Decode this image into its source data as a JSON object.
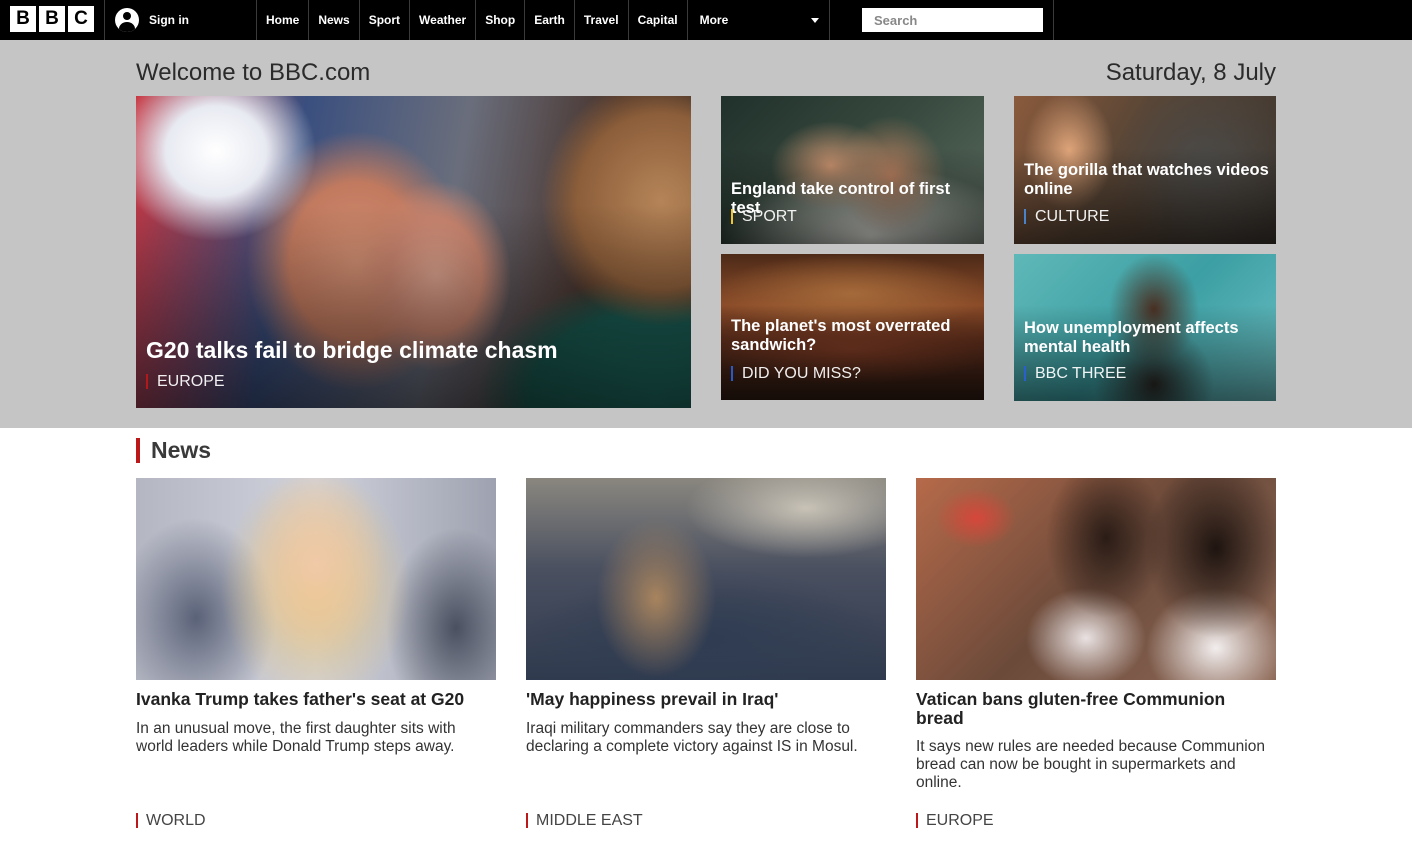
{
  "header": {
    "logo_letters": [
      "B",
      "B",
      "C"
    ],
    "signin_label": "Sign in",
    "nav": [
      "Home",
      "News",
      "Sport",
      "Weather",
      "Shop",
      "Earth",
      "Travel",
      "Capital"
    ],
    "more_label": "More",
    "search_placeholder": "Search"
  },
  "hero": {
    "welcome": "Welcome to BBC.com",
    "date": "Saturday, 8 July",
    "main": {
      "title": "G20 talks fail to bridge climate chasm",
      "tag": "EUROPE",
      "tag_color": "#bb1919"
    },
    "cards": [
      {
        "title": "England take control of first test",
        "tag": "SPORT",
        "tag_color": "#ffd230"
      },
      {
        "title": "The gorilla that watches videos online",
        "tag": "CULTURE",
        "tag_color": "#4a8bd6"
      },
      {
        "title": "The planet's most overrated sandwich?",
        "tag": "DID YOU MISS?",
        "tag_color": "#2a5fd6"
      },
      {
        "title": "How unemployment affects mental health",
        "tag": "BBC THREE",
        "tag_color": "#2a5fd6"
      }
    ]
  },
  "news": {
    "heading": "News",
    "accent": "#bb1919",
    "stories": [
      {
        "title": "Ivanka Trump takes father's seat at G20",
        "desc": "In an unusual move, the first daughter sits with world leaders while Donald Trump steps away.",
        "tag": "WORLD"
      },
      {
        "title": "'May happiness prevail in Iraq'",
        "desc": "Iraqi military commanders say they are close to declaring a complete victory against IS in Mosul.",
        "tag": "MIDDLE EAST"
      },
      {
        "title": "Vatican bans gluten-free Communion bread",
        "desc": "It says new rules are needed because Communion bread can now be bought in supermarkets and online.",
        "tag": "EUROPE"
      }
    ]
  },
  "icons": {
    "user": "user-icon",
    "caret": "chevron-down-icon"
  }
}
